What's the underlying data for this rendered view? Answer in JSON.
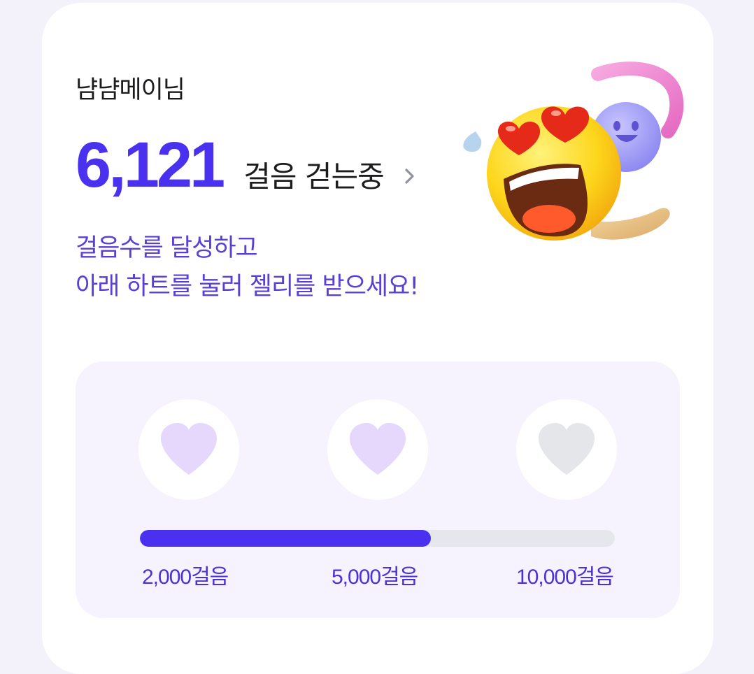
{
  "user": {
    "name": "냠냠메이님"
  },
  "steps": {
    "count": "6,121",
    "suffix": "걸음 걷는중"
  },
  "message": {
    "line1": "걸음수를 달성하고",
    "line2": "아래 하트를 눌러 젤리를 받으세요!"
  },
  "progress": {
    "fraction": 0.612,
    "milestones": [
      "2,000걸음",
      "5,000걸음",
      "10,000걸음"
    ]
  },
  "hearts": [
    {
      "state": "active",
      "icon": "heart-icon"
    },
    {
      "state": "active",
      "icon": "heart-icon"
    },
    {
      "state": "inactive",
      "icon": "heart-icon"
    }
  ],
  "colors": {
    "accent": "#4a31f0",
    "heart_active": "#e6d8fc",
    "heart_inactive": "#e4e6ea",
    "panel_bg": "#f6f3fe",
    "message_text": "#5a3fd6"
  }
}
